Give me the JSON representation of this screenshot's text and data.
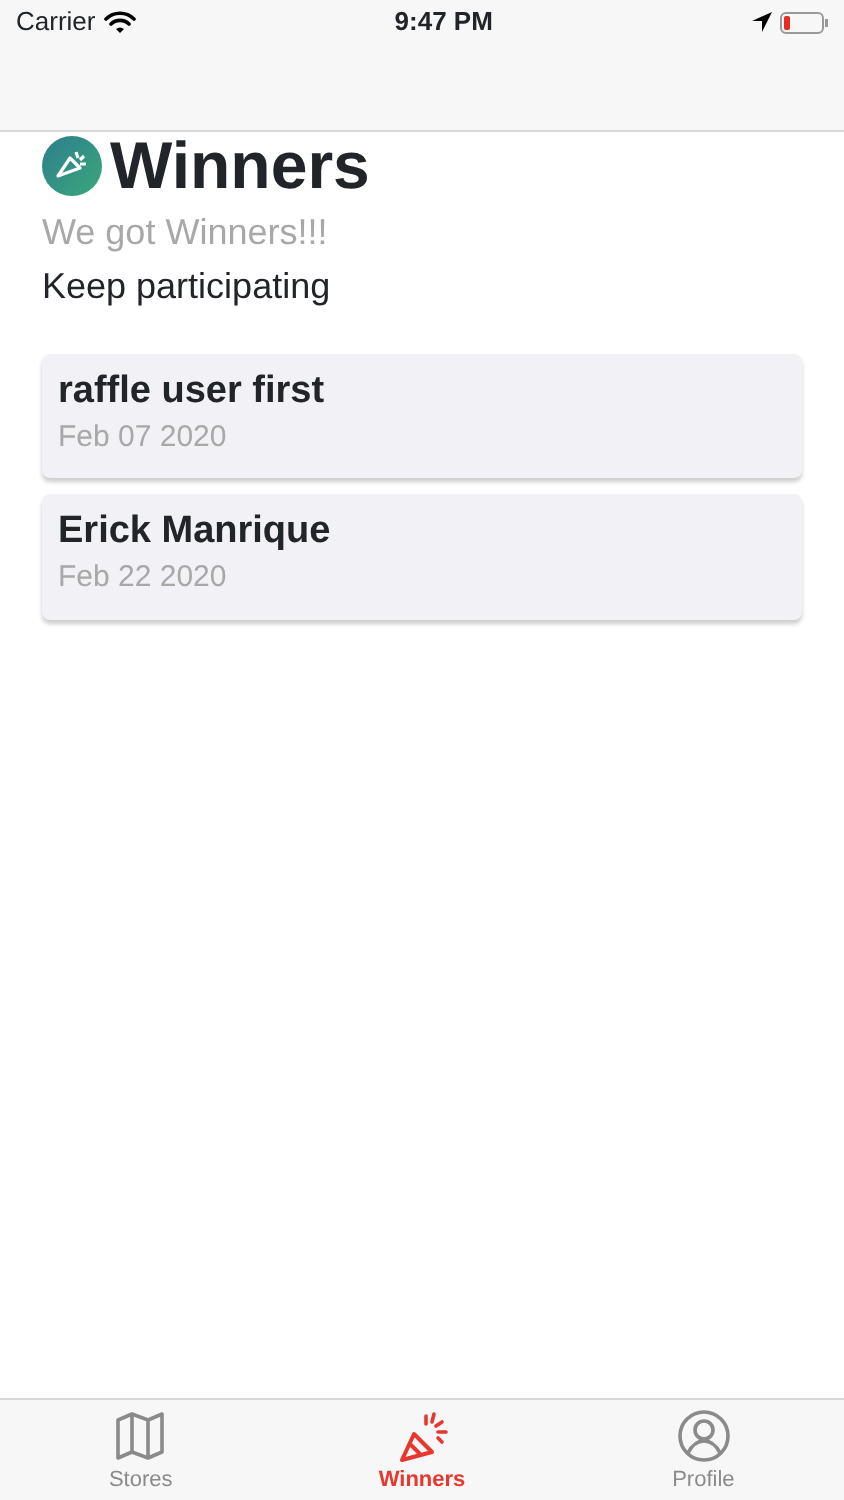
{
  "status_bar": {
    "carrier": "Carrier",
    "time": "9:47 PM"
  },
  "header": {
    "title": "Winners",
    "subtitle": "We got Winners!!!",
    "message": "Keep participating"
  },
  "winners": [
    {
      "name": "raffle user first",
      "date": "Feb 07 2020"
    },
    {
      "name": "Erick Manrique",
      "date": "Feb 22 2020"
    }
  ],
  "tabs": [
    {
      "label": "Stores",
      "kind": "map",
      "selected": false
    },
    {
      "label": "Winners",
      "kind": "party",
      "selected": true
    },
    {
      "label": "Profile",
      "kind": "person",
      "selected": false
    }
  ]
}
